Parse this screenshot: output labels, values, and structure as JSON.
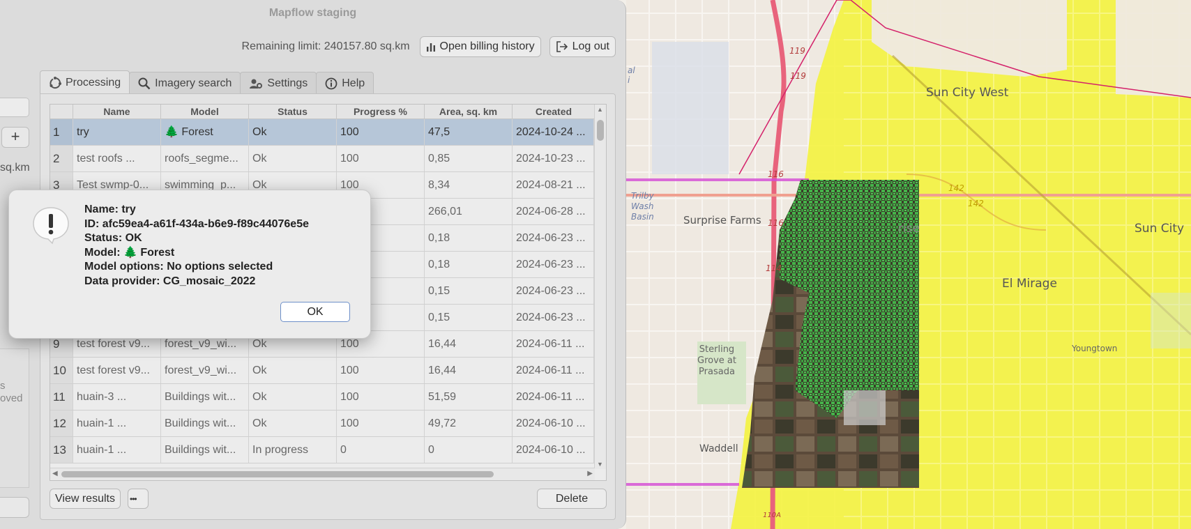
{
  "window": {
    "title": "Mapflow staging"
  },
  "left_strip": {
    "sqkm_label": "sq.km",
    "moved_label": "s oved",
    "plus_label": "+"
  },
  "topbar": {
    "remaining_limit": "Remaining limit: 240157.80 sq.km",
    "billing_button": "Open billing history",
    "logout_button": "Log out"
  },
  "tabs": [
    {
      "label": "Processing",
      "icon": "processing-icon",
      "active": true
    },
    {
      "label": "Imagery search",
      "icon": "search-icon",
      "active": false
    },
    {
      "label": "Settings",
      "icon": "settings-icon",
      "active": false
    },
    {
      "label": "Help",
      "icon": "info-icon",
      "active": false
    }
  ],
  "table": {
    "columns": [
      "Name",
      "Model",
      "Status",
      "Progress %",
      "Area, sq. km",
      "Created"
    ],
    "rows": [
      {
        "num": "1",
        "name": "try",
        "model": "🌲 Forest",
        "status": "Ok",
        "progress": "100",
        "area": "47,5",
        "created": "2024-10-24 ..."
      },
      {
        "num": "2",
        "name": "test roofs ...",
        "model": "roofs_segme...",
        "status": "Ok",
        "progress": "100",
        "area": "0,85",
        "created": "2024-10-23 ..."
      },
      {
        "num": "3",
        "name": "Test swmp-0...",
        "model": "swimming_p...",
        "status": "Ok",
        "progress": "100",
        "area": "8,34",
        "created": "2024-08-21 ..."
      },
      {
        "num": "4",
        "name": "",
        "model": "",
        "status": "",
        "progress": "",
        "area": "266,01",
        "created": "2024-06-28 ..."
      },
      {
        "num": "5",
        "name": "",
        "model": "",
        "status": "",
        "progress": "",
        "area": "0,18",
        "created": "2024-06-23 ..."
      },
      {
        "num": "6",
        "name": "",
        "model": "",
        "status": "",
        "progress": "",
        "area": "0,18",
        "created": "2024-06-23 ..."
      },
      {
        "num": "7",
        "name": "",
        "model": "",
        "status": "",
        "progress": "",
        "area": "0,15",
        "created": "2024-06-23 ..."
      },
      {
        "num": "8",
        "name": "",
        "model": "",
        "status": "",
        "progress": "",
        "area": "0,15",
        "created": "2024-06-23 ..."
      },
      {
        "num": "9",
        "name": "test forest v9...",
        "model": "forest_v9_wi...",
        "status": "Ok",
        "progress": "100",
        "area": "16,44",
        "created": "2024-06-11 ..."
      },
      {
        "num": "10",
        "name": "test forest v9...",
        "model": "forest_v9_wi...",
        "status": "Ok",
        "progress": "100",
        "area": "16,44",
        "created": "2024-06-11 ..."
      },
      {
        "num": "11",
        "name": "huain-3 ...",
        "model": "Buildings wit...",
        "status": "Ok",
        "progress": "100",
        "area": "51,59",
        "created": "2024-06-11 ..."
      },
      {
        "num": "12",
        "name": "huain-1 ...",
        "model": "Buildings wit...",
        "status": "Ok",
        "progress": "100",
        "area": "49,72",
        "created": "2024-06-10 ..."
      },
      {
        "num": "13",
        "name": "huain-1 ...",
        "model": "Buildings wit...",
        "status": "In progress",
        "progress": "0",
        "area": "0",
        "created": "2024-06-10 ..."
      }
    ],
    "selected_row": 1
  },
  "bottom": {
    "view_results": "View results",
    "more": "•••",
    "delete": "Delete"
  },
  "dialog": {
    "lines": [
      "Name: try",
      "ID: afc59ea4-a61f-434a-b6e9-f89c44076e5e",
      "Status: OK",
      "Model: 🌲 Forest",
      "Model options: No options selected",
      "Data provider: CG_mosaic_2022"
    ],
    "ok_button": "OK",
    "icon": "warning-icon"
  },
  "map": {
    "labels": {
      "sun_city_west": "Sun City West",
      "surprise_farms": "Surprise Farms",
      "rise": "rise",
      "sun_city": "Sun City",
      "el_mirage": "El Mirage",
      "youngtown": "Youngtown",
      "sterling": "Sterling Grove at Prasada",
      "waddell": "Waddell",
      "trilby": "Trilby Wash Basin",
      "wash": "al i",
      "r119a": "119",
      "r119b": "119",
      "r116a": "116",
      "r116b": "116",
      "r114": "114",
      "r142a": "142",
      "r142b": "142",
      "r110": "110A"
    },
    "colors": {
      "yellow_overlay": "#f4f23a",
      "forest_green": "#3fae3f",
      "road_pink": "#e8637c",
      "magenta_line": "#d44ad4"
    }
  }
}
